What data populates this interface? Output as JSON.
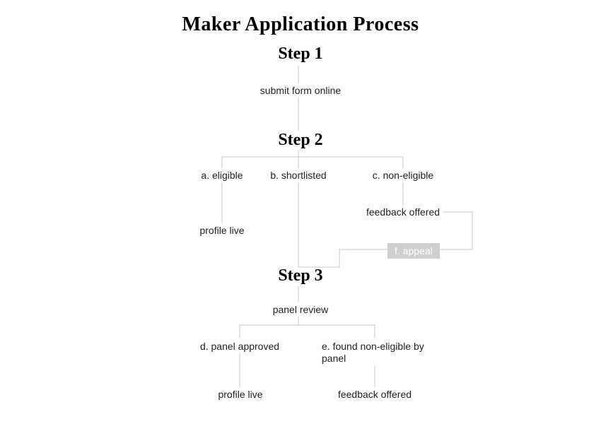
{
  "title": "Maker Application Process",
  "step1": {
    "heading": "Step 1",
    "action": "submit form online"
  },
  "step2": {
    "heading": "Step 2",
    "a": "a. eligible",
    "a_result": "profile live",
    "b": "b. shortlisted",
    "c": "c. non-eligible",
    "c_result": "feedback offered",
    "f": "f. appeal"
  },
  "step3": {
    "heading": "Step 3",
    "action": "panel review",
    "d": "d. panel approved",
    "d_result": "profile live",
    "e": "e. found non-eligible by panel",
    "e_result": "feedback offered"
  }
}
